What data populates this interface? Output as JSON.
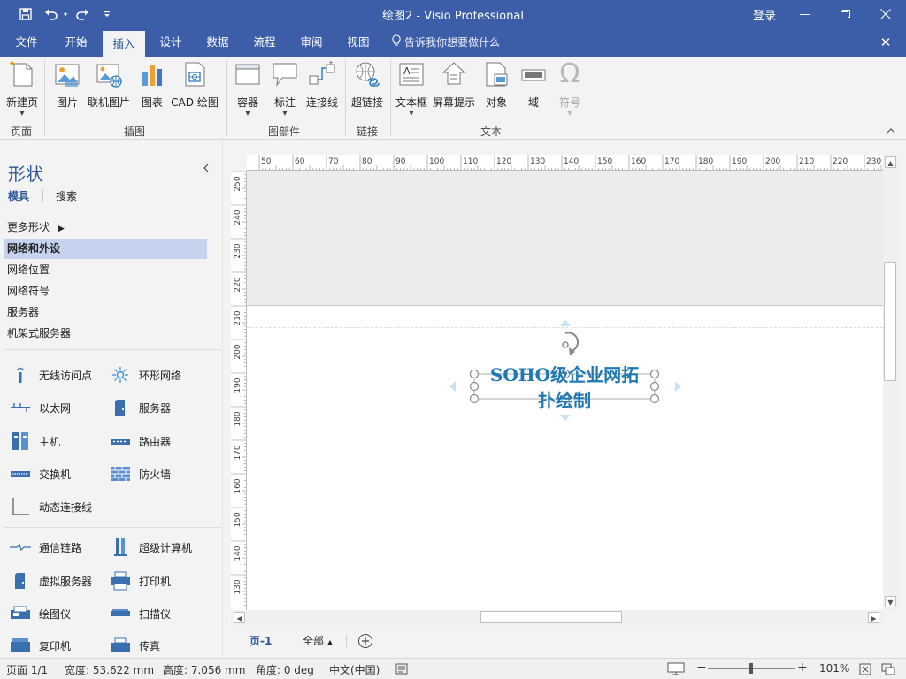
{
  "titlebar": {
    "title": "绘图2 - Visio Professional",
    "login": "登录",
    "quick_access": [
      "save-icon",
      "undo-icon",
      "redo-icon",
      "customize-icon"
    ]
  },
  "tabs": [
    {
      "label": "文件",
      "active": false
    },
    {
      "label": "开始",
      "active": false
    },
    {
      "label": "插入",
      "active": true
    },
    {
      "label": "设计",
      "active": false
    },
    {
      "label": "数据",
      "active": false
    },
    {
      "label": "流程",
      "active": false
    },
    {
      "label": "审阅",
      "active": false
    },
    {
      "label": "视图",
      "active": false
    }
  ],
  "tell_me": "告诉我你想要做什么",
  "ribbon": {
    "groups": {
      "pages": "页面",
      "illustrations": "插图",
      "diagram_parts": "图部件",
      "links": "链接",
      "text": "文本"
    },
    "buttons": {
      "new_page": "新建页",
      "pictures": "图片",
      "online_pictures": "联机图片",
      "chart": "图表",
      "cad": "CAD 绘图",
      "container": "容器",
      "callout": "标注",
      "connector": "连接线",
      "hyperlink": "超链接",
      "textbox": "文本框",
      "screentip": "屏幕提示",
      "object": "对象",
      "field": "域",
      "symbol": "符号"
    }
  },
  "shapes_pane": {
    "title": "形状",
    "tabs": [
      "模具",
      "搜索"
    ],
    "more_shapes": "更多形状",
    "stencils": [
      {
        "label": "网络和外设",
        "active": true
      },
      {
        "label": "网络位置",
        "active": false
      },
      {
        "label": "网络符号",
        "active": false
      },
      {
        "label": "服务器",
        "active": false
      },
      {
        "label": "机架式服务器",
        "active": false
      }
    ],
    "shapes": [
      {
        "label": "无线访问点",
        "icon": "wireless-access-point-icon"
      },
      {
        "label": "环形网络",
        "icon": "ring-network-icon"
      },
      {
        "label": "以太网",
        "icon": "ethernet-icon"
      },
      {
        "label": "服务器",
        "icon": "server-icon"
      },
      {
        "label": "主机",
        "icon": "mainframe-icon"
      },
      {
        "label": "路由器",
        "icon": "router-icon"
      },
      {
        "label": "交换机",
        "icon": "switch-icon"
      },
      {
        "label": "防火墙",
        "icon": "firewall-icon"
      },
      {
        "label": "动态连接线",
        "icon": "dynamic-connector-icon"
      },
      {
        "label": "通信链路",
        "icon": "comm-link-icon"
      },
      {
        "label": "超级计算机",
        "icon": "supercomputer-icon"
      },
      {
        "label": "虚拟服务器",
        "icon": "virtual-server-icon"
      },
      {
        "label": "打印机",
        "icon": "printer-icon"
      },
      {
        "label": "绘图仪",
        "icon": "plotter-icon"
      },
      {
        "label": "扫描仪",
        "icon": "scanner-icon"
      },
      {
        "label": "复印机",
        "icon": "copier-icon"
      },
      {
        "label": "传真",
        "icon": "fax-icon"
      }
    ]
  },
  "rulers": {
    "horizontal": [
      "50",
      "60",
      "70",
      "80",
      "90",
      "100",
      "110",
      "120",
      "130",
      "140",
      "150",
      "160",
      "170",
      "180",
      "190",
      "200",
      "210",
      "220",
      "230"
    ],
    "vertical": [
      "250",
      "240",
      "230",
      "220",
      "210",
      "200",
      "190",
      "180",
      "170",
      "160",
      "150",
      "140",
      "130"
    ]
  },
  "canvas": {
    "textbox_line1": "SOHO级企业网拓",
    "textbox_line2": "扑绘制"
  },
  "page_tabs": {
    "page": "页-1",
    "all": "全部"
  },
  "statusbar": {
    "page": "页面 1/1",
    "width": "宽度: 53.622 mm",
    "height": "高度: 7.056 mm",
    "angle": "角度: 0 deg",
    "language": "中文(中国)",
    "zoom": "101%"
  }
}
